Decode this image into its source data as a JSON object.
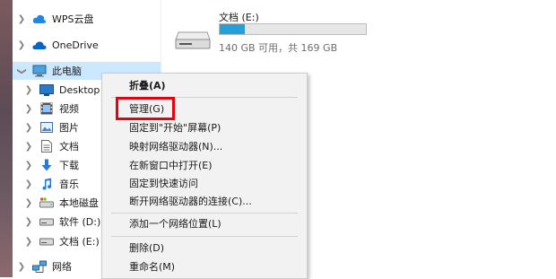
{
  "nav": {
    "items": [
      {
        "label": "WPS云盘",
        "icon": "cloud-icon"
      },
      {
        "label": "OneDrive",
        "icon": "onedrive-icon"
      },
      {
        "label": "此电脑",
        "icon": "computer-icon"
      },
      {
        "label": "Desktop",
        "icon": "desktop-folder-icon"
      },
      {
        "label": "视频",
        "icon": "video-folder-icon"
      },
      {
        "label": "图片",
        "icon": "pictures-folder-icon"
      },
      {
        "label": "文档",
        "icon": "documents-folder-icon"
      },
      {
        "label": "下载",
        "icon": "download-icon"
      },
      {
        "label": "音乐",
        "icon": "music-icon"
      },
      {
        "label": "本地磁盘 (C",
        "icon": "local-disk-icon"
      },
      {
        "label": "软件 (D:)",
        "icon": "drive-icon"
      },
      {
        "label": "文档 (E:)",
        "icon": "drive-icon"
      },
      {
        "label": "网络",
        "icon": "network-icon"
      }
    ]
  },
  "drive": {
    "name": "文档 (E:)",
    "free_text": "140 GB 可用，共 169 GB",
    "used_fraction": 0.17,
    "bar_color": "#26a0da"
  },
  "menu": {
    "items": [
      {
        "label": "折叠(A)"
      },
      {
        "label": "管理(G)"
      },
      {
        "label": "固定到\"开始\"屏幕(P)"
      },
      {
        "label": "映射网络驱动器(N)..."
      },
      {
        "label": "在新窗口中打开(E)"
      },
      {
        "label": "固定到快速访问"
      },
      {
        "label": "断开网络驱动器的连接(C)..."
      },
      {
        "label": "添加一个网络位置(L)"
      },
      {
        "label": "删除(D)"
      },
      {
        "label": "重命名(M)"
      }
    ],
    "highlight_color": "#e8000d"
  }
}
